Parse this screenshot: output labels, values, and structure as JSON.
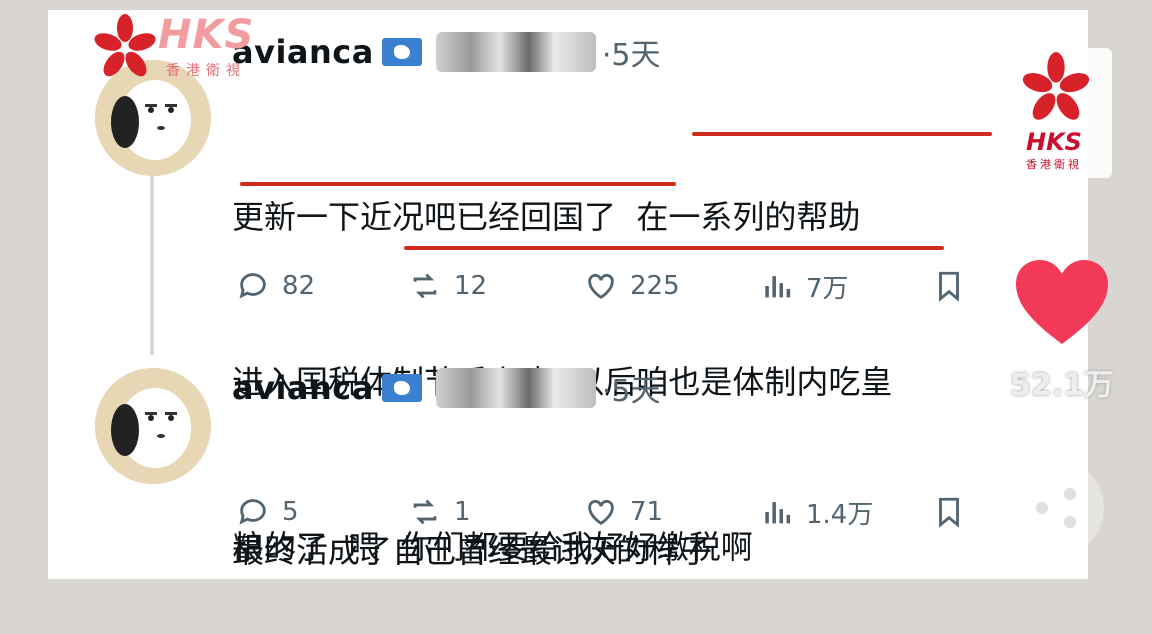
{
  "posts": [
    {
      "username": "avianca",
      "time": "·5天",
      "lines": [
        "更新一下近况吧已经回国了  在一系列的帮助",
        "进入国税体制节后上班  以后咱也是体制内吃皇",
        "粮的了  喂  你们都要给我好好缴税啊"
      ],
      "actions": {
        "replies": "82",
        "reposts": "12",
        "likes": "225",
        "views": "7万"
      }
    },
    {
      "username": "avianca",
      "time": "·5天",
      "lines": [
        "最终活成了自己曾经最讨厌的样子"
      ],
      "actions": {
        "replies": "5",
        "reposts": "1",
        "likes": "71",
        "views": "1.4万"
      }
    }
  ],
  "overlay": {
    "watermark_brand": "HKS",
    "watermark_sub": "香港衛視",
    "like_total": "52.1万"
  },
  "colors": {
    "underline": "#d22a1e",
    "text": "#0f1419",
    "muted": "#536471",
    "heart": "#f23a58",
    "flag": "#3a7fd0"
  },
  "icons": [
    "reply-icon",
    "repost-icon",
    "like-icon",
    "views-icon",
    "bookmark-icon",
    "heart-icon",
    "bauhinia-icon",
    "share-icon"
  ]
}
